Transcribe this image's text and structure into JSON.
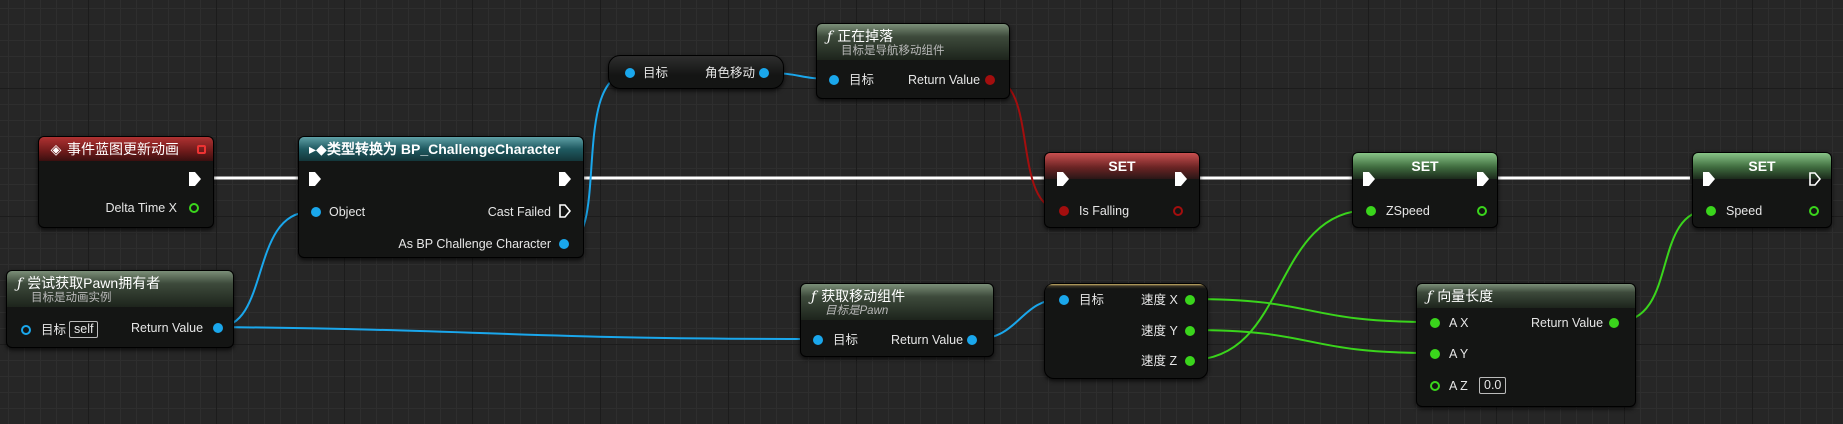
{
  "nodes": {
    "event": {
      "title": "事件蓝图更新动画",
      "delta_label": "Delta Time X"
    },
    "owner": {
      "title": "尝试获取Pawn拥有者",
      "subtitle": "目标是动画实例",
      "target_label": "目标",
      "self_label": "self",
      "return_label": "Return Value"
    },
    "cast": {
      "title": "类型转换为 BP_ChallengeCharacter",
      "object_label": "Object",
      "cast_failed_label": "Cast Failed",
      "as_label": "As BP Challenge Character"
    },
    "charmove": {
      "target_label": "目标",
      "output_label": "角色移动"
    },
    "falling": {
      "title": "正在掉落",
      "subtitle": "目标是导航移动组件",
      "target_label": "目标",
      "return_label": "Return Value"
    },
    "getmove": {
      "title": "获取移动组件",
      "subtitle": "目标是Pawn",
      "target_label": "目标",
      "return_label": "Return Value"
    },
    "breakvec": {
      "target_label": "目标",
      "x_label": "速度 X",
      "y_label": "速度 Y",
      "z_label": "速度 Z"
    },
    "set_falling": {
      "title": "SET",
      "var_label": "Is Falling"
    },
    "set_zspeed": {
      "title": "SET",
      "var_label": "ZSpeed"
    },
    "veclen": {
      "title": "向量长度",
      "ax_label": "A X",
      "ay_label": "A Y",
      "az_label": "A Z",
      "az_value": "0.0",
      "return_label": "Return Value"
    },
    "set_speed": {
      "title": "SET",
      "var_label": "Speed"
    }
  },
  "colors": {
    "exec": "#ffffff",
    "object": "#1aa7ec",
    "float": "#3ad51c",
    "bool": "#a30e0e"
  }
}
